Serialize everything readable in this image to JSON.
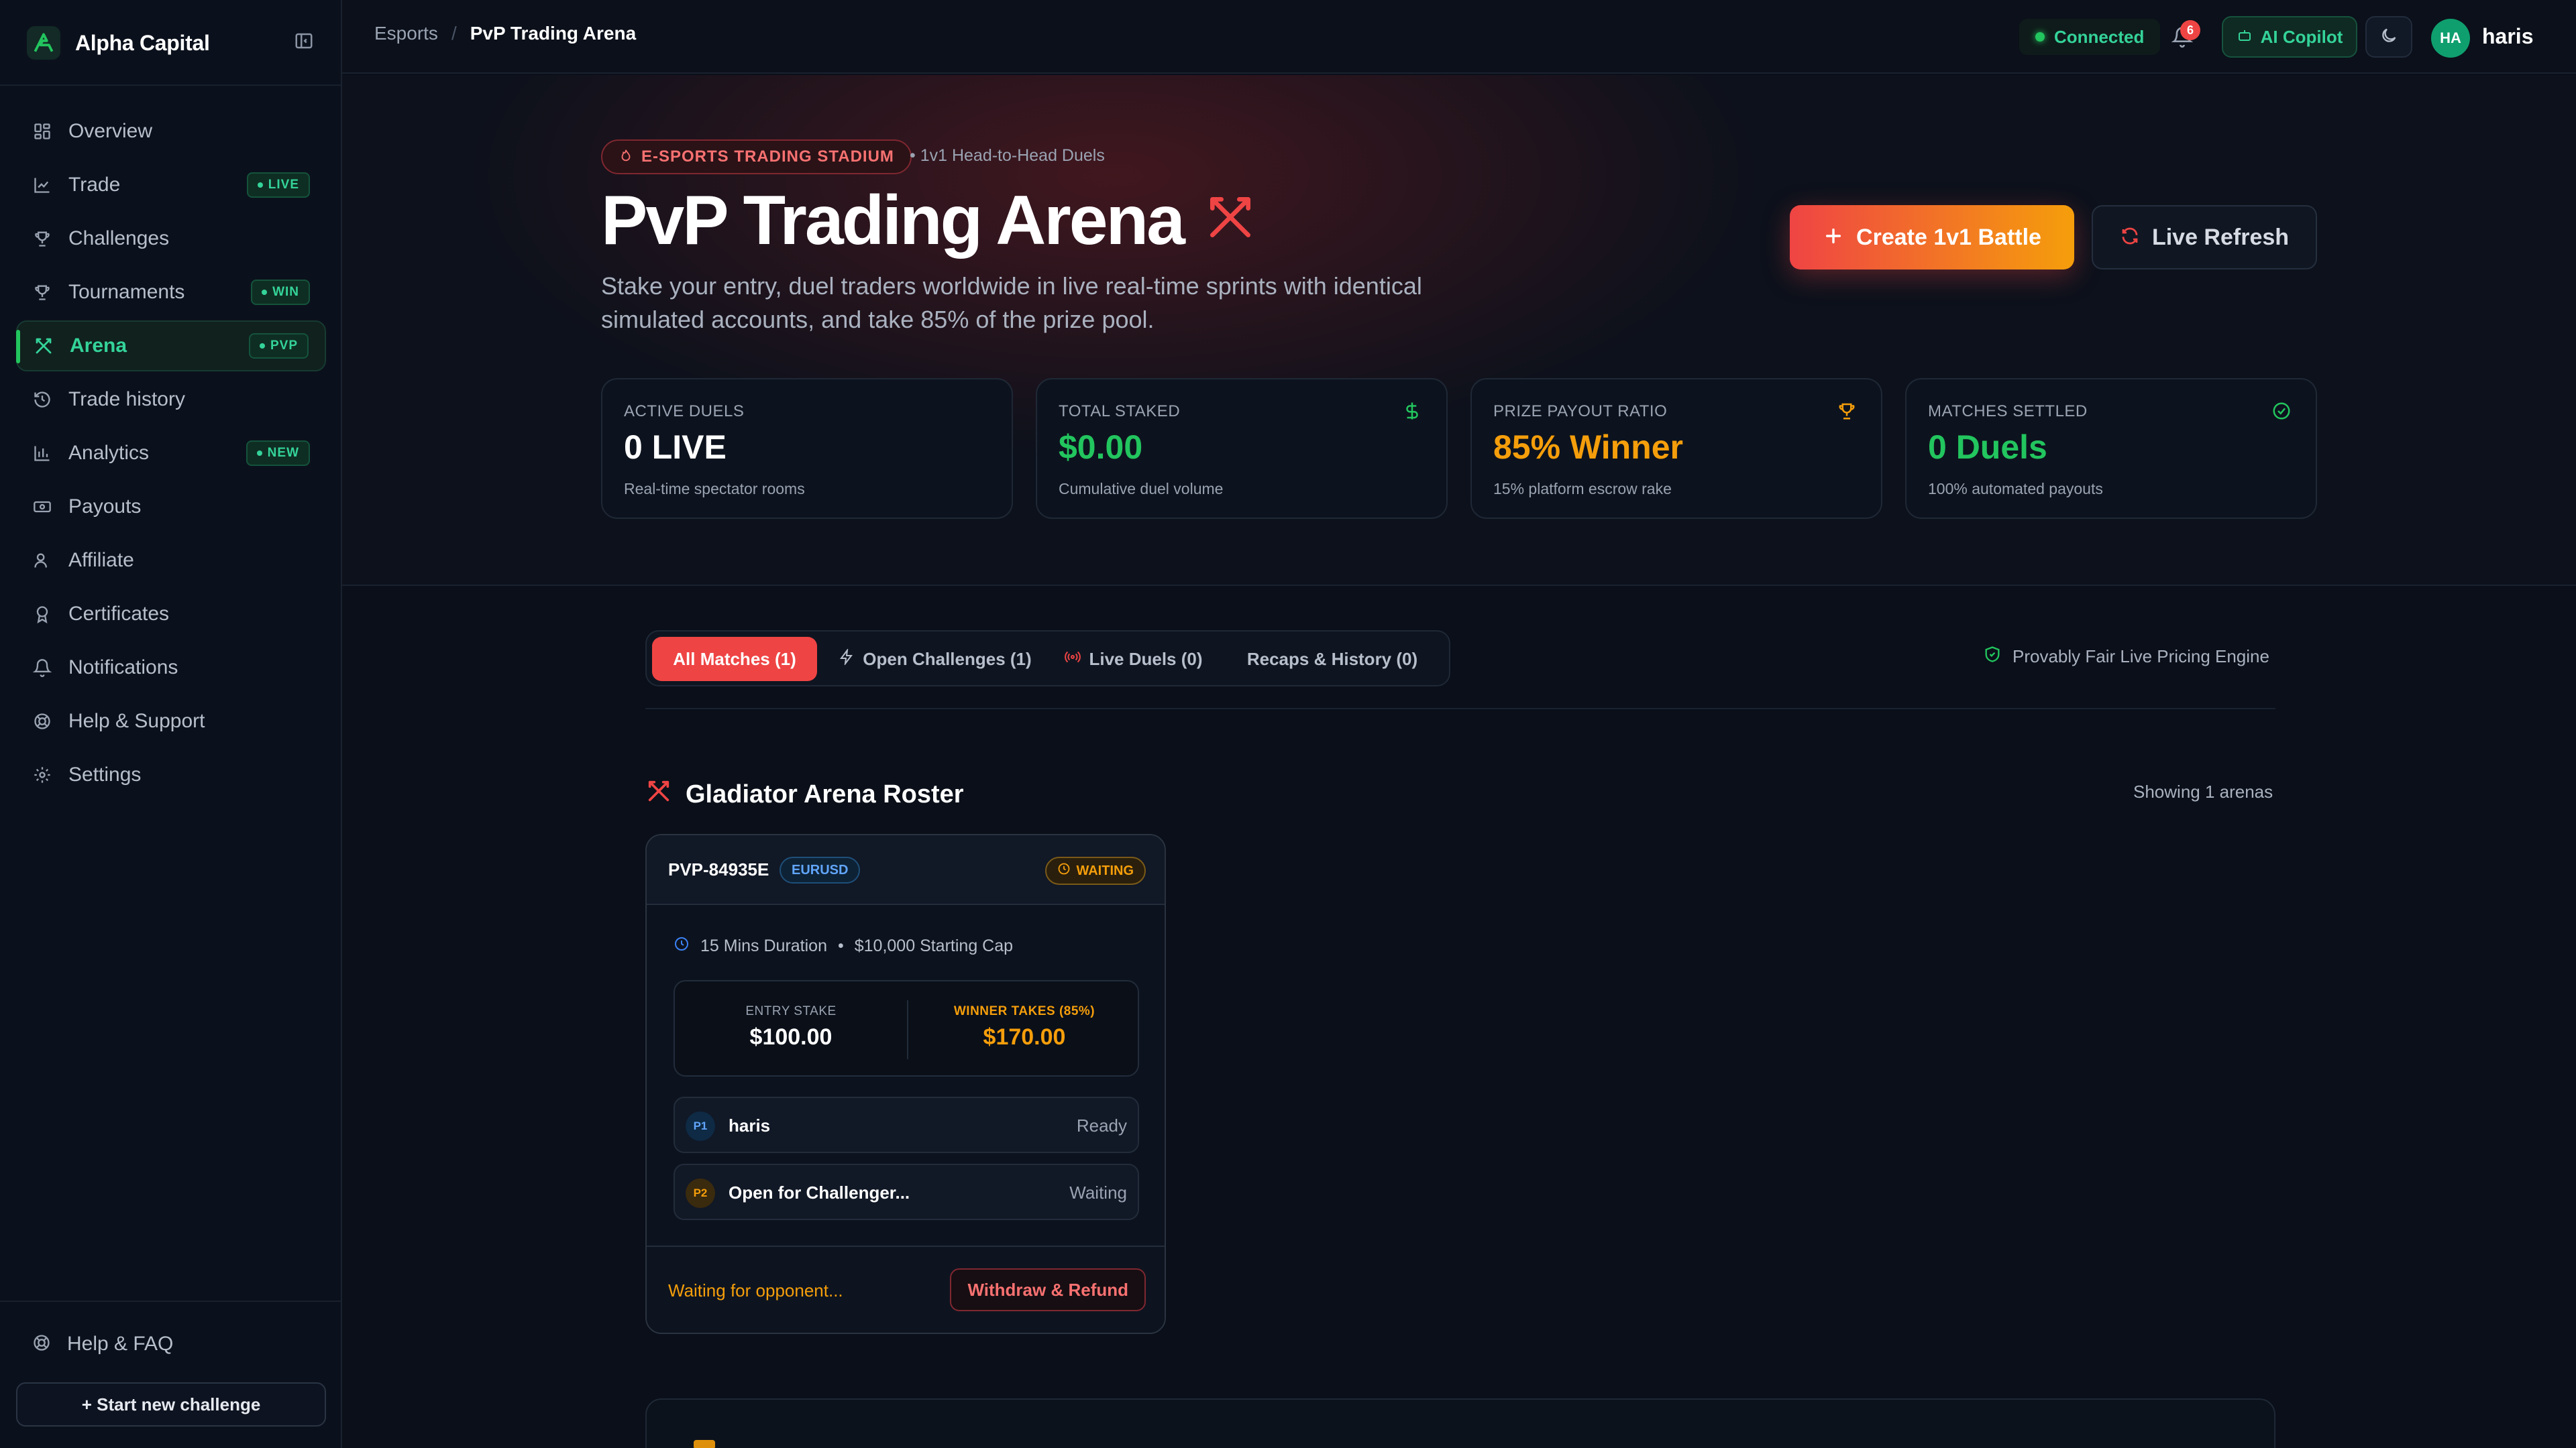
{
  "brand": {
    "name": "Alpha Capital"
  },
  "sidebar": {
    "items": [
      {
        "label": "Overview",
        "icon": "grid-icon",
        "badge": ""
      },
      {
        "label": "Trade",
        "icon": "chart-icon",
        "badge": "LIVE"
      },
      {
        "label": "Challenges",
        "icon": "trophy-icon",
        "badge": ""
      },
      {
        "label": "Tournaments",
        "icon": "trophy-icon",
        "badge": "WIN"
      },
      {
        "label": "Arena",
        "icon": "crossed-swords-icon",
        "badge": "PVP",
        "active": true
      },
      {
        "label": "Trade history",
        "icon": "history-icon",
        "badge": ""
      },
      {
        "label": "Analytics",
        "icon": "bar-chart-icon",
        "badge": "NEW"
      },
      {
        "label": "Payouts",
        "icon": "banknote-icon",
        "badge": ""
      },
      {
        "label": "Affiliate",
        "icon": "users-icon",
        "badge": ""
      },
      {
        "label": "Certificates",
        "icon": "award-icon",
        "badge": ""
      },
      {
        "label": "Notifications",
        "icon": "bell-icon",
        "badge": ""
      },
      {
        "label": "Help & Support",
        "icon": "lifebuoy-icon",
        "badge": ""
      },
      {
        "label": "Settings",
        "icon": "gear-icon",
        "badge": ""
      }
    ],
    "help_faq": "Help & FAQ",
    "start_button": "+ Start new challenge"
  },
  "topbar": {
    "breadcrumb": [
      "Esports",
      "PvP Trading Arena"
    ],
    "connection": "Connected",
    "notification_count": "6",
    "copilot": "AI Copilot",
    "avatar_initials": "HA",
    "username": "haris"
  },
  "hero": {
    "pill": "E-SPORTS TRADING STADIUM",
    "sub_pill": "• 1v1 Head-to-Head Duels",
    "title": "PvP Trading Arena",
    "description": "Stake your entry, duel traders worldwide in live real-time sprints with identical simulated accounts, and take 85% of the prize pool.",
    "create_button": "Create 1v1 Battle",
    "refresh_button": "Live Refresh"
  },
  "stats": [
    {
      "label": "ACTIVE DUELS",
      "value": "0 LIVE",
      "sub": "Real-time spectator rooms",
      "color": "#ffffff",
      "icon": ""
    },
    {
      "label": "TOTAL STAKED",
      "value": "$0.00",
      "sub": "Cumulative duel volume",
      "color": "#22c55e",
      "icon": "dollar-icon"
    },
    {
      "label": "PRIZE PAYOUT RATIO",
      "value": "85% Winner",
      "sub": "15% platform escrow rake",
      "color": "#f59e0b",
      "icon": "trophy-icon"
    },
    {
      "label": "MATCHES SETTLED",
      "value": "0 Duels",
      "sub": "100% automated payouts",
      "color": "#22c55e",
      "icon": "check-circle-icon"
    }
  ],
  "tabs": [
    {
      "label": "All Matches (1)",
      "active": true
    },
    {
      "label": "Open Challenges (1)"
    },
    {
      "label": "Live Duels (0)"
    },
    {
      "label": "Recaps & History (0)"
    }
  ],
  "fair_engine": "Provably Fair Live Pricing Engine",
  "roster": {
    "title": "Gladiator Arena Roster",
    "showing": "Showing 1 arenas"
  },
  "arena": {
    "id": "PVP-84935E",
    "pair": "EURUSD",
    "status": "WAITING",
    "duration": "15 Mins Duration",
    "capital": "$10,000 Starting Cap",
    "entry_label": "ENTRY STAKE",
    "entry_value": "$100.00",
    "winner_label": "WINNER TAKES (85%)",
    "winner_value": "$170.00",
    "players": [
      {
        "badge": "P1",
        "name": "haris",
        "status": "Ready"
      },
      {
        "badge": "P2",
        "name": "Open for Challenger...",
        "status": "Waiting"
      }
    ],
    "footer_text": "Waiting for opponent...",
    "withdraw_button": "Withdraw & Refund"
  },
  "colors": {
    "accent_green": "#22c55e",
    "accent_red": "#ef4444",
    "accent_amber": "#f59e0b",
    "background": "#0a0f19"
  }
}
